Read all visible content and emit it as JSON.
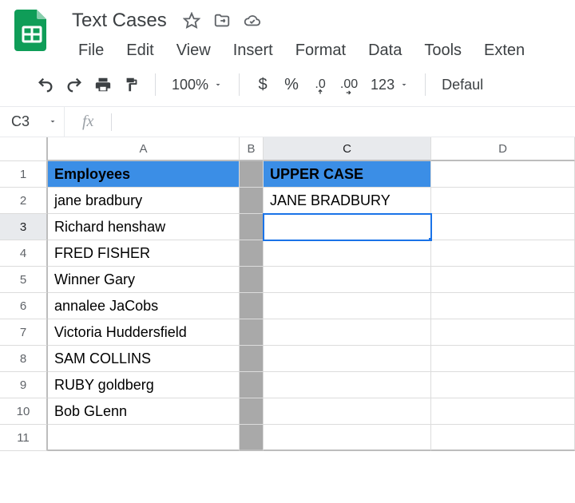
{
  "doc": {
    "title": "Text Cases"
  },
  "menu": {
    "file": "File",
    "edit": "Edit",
    "view": "View",
    "insert": "Insert",
    "format": "Format",
    "data": "Data",
    "tools": "Tools",
    "exten": "Exten"
  },
  "toolbar": {
    "zoom": "100%",
    "currency": "$",
    "percent": "%",
    "dec_dec": ".0",
    "inc_dec": ".00",
    "numfmt": "123",
    "font": "Defaul"
  },
  "namebox": {
    "ref": "C3",
    "fx": "fx",
    "formula": ""
  },
  "columns": {
    "A": "A",
    "B": "B",
    "C": "C",
    "D": "D"
  },
  "rows": {
    "1": "1",
    "2": "2",
    "3": "3",
    "4": "4",
    "5": "5",
    "6": "6",
    "7": "7",
    "8": "8",
    "9": "9",
    "10": "10",
    "11": "11"
  },
  "selected": {
    "col": "C",
    "row": 3
  },
  "cells": {
    "A1": "Employees",
    "C1": "UPPER CASE",
    "A2": "jane bradbury",
    "C2": "JANE BRADBURY",
    "A3": "Richard henshaw",
    "A4": "FRED FISHER",
    "A5": "Winner Gary",
    "A6": "annalee JaCobs",
    "A7": "Victoria Huddersfield",
    "A8": "SAM COLLINS",
    "A9": "RUBY goldberg",
    "A10": "Bob GLenn"
  }
}
